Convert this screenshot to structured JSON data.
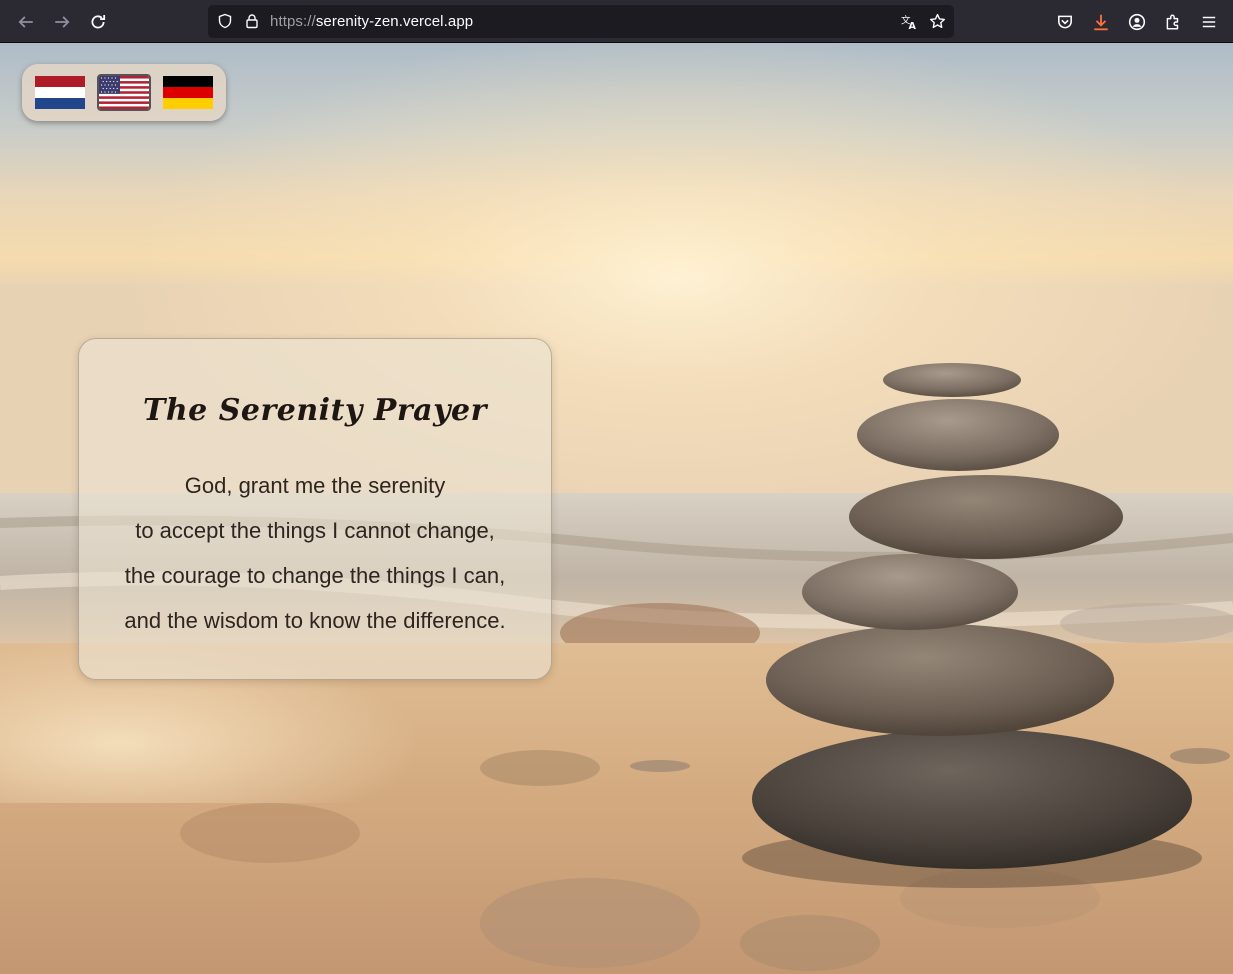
{
  "browser": {
    "url_protocol": "https://",
    "url_host": "serenity-zen.vercel.app",
    "icons": {
      "back": "back-arrow-icon",
      "forward": "forward-arrow-icon",
      "reload": "reload-icon",
      "tracking": "shield-icon",
      "lock": "lock-icon",
      "translate": "translate-icon",
      "bookmark": "star-icon",
      "pocket": "pocket-icon",
      "downloads": "download-icon",
      "account": "account-icon",
      "extensions": "extensions-icon",
      "menu": "hamburger-menu-icon"
    },
    "download_accent": "#ff7139"
  },
  "languages": {
    "options": [
      {
        "code": "nl",
        "name": "Netherlands flag"
      },
      {
        "code": "en-US",
        "name": "United States flag",
        "selected": true
      },
      {
        "code": "de",
        "name": "Germany flag"
      }
    ]
  },
  "prayer": {
    "title": "The Serenity Prayer",
    "lines": [
      "God, grant me the serenity",
      "to accept the things I cannot change,",
      "the courage to change the things I can,",
      "and the wisdom to know the difference."
    ]
  },
  "background": {
    "description_icon": "zen-stones-beach-image"
  }
}
